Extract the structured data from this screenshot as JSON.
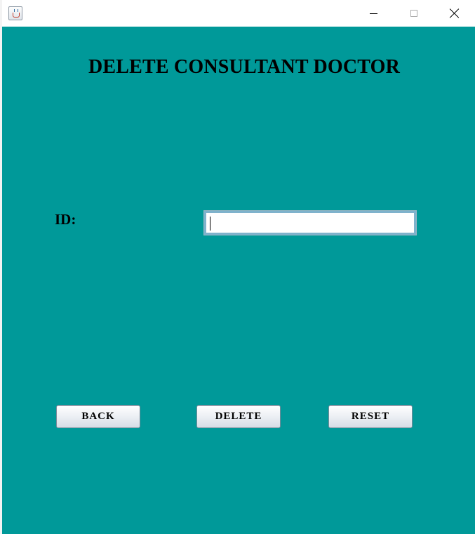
{
  "window": {
    "title": "",
    "icon": "java-cup-icon",
    "controls": {
      "minimize": "minimize-icon",
      "maximize": "maximize-icon",
      "close": "close-icon"
    }
  },
  "form": {
    "heading": "DELETE CONSULTANT DOCTOR",
    "background_color": "#009999",
    "id_label": "ID:",
    "id_value": "",
    "id_placeholder": ""
  },
  "buttons": {
    "back": "BACK",
    "delete": "DELETE",
    "reset": "RESET"
  }
}
